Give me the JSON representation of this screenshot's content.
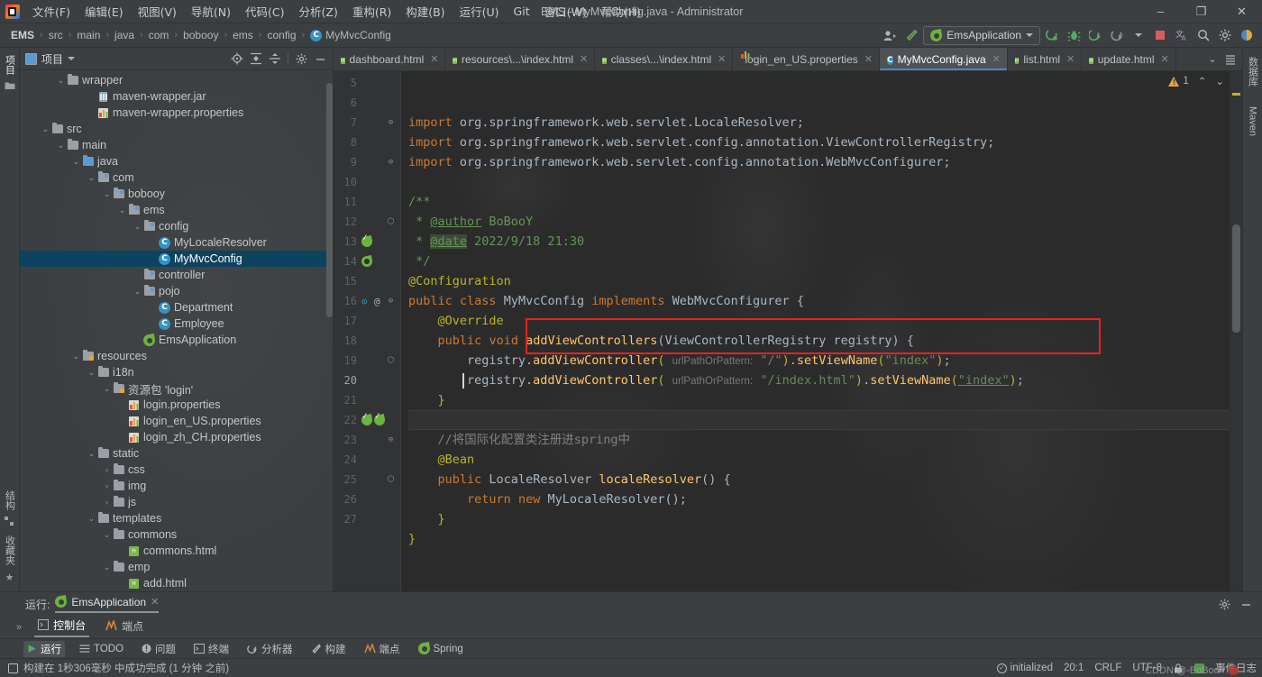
{
  "window": {
    "title": "EMS - MyMvcConfig.java - Administrator",
    "minimize": "–",
    "maximize": "❐",
    "close": "✕"
  },
  "menubar": {
    "items": [
      "文件(F)",
      "编辑(E)",
      "视图(V)",
      "导航(N)",
      "代码(C)",
      "分析(Z)",
      "重构(R)",
      "构建(B)",
      "运行(U)",
      "Git",
      "窗口(W)",
      "帮助(H)"
    ]
  },
  "navbar": {
    "breadcrumbs": [
      "EMS",
      "src",
      "main",
      "java",
      "com",
      "bobooy",
      "ems",
      "config"
    ],
    "current_file": "MyMvcConfig",
    "current_file_icon": "C",
    "separator": "›",
    "run_config": "EmsApplication",
    "icons": [
      "user-avatar-icon",
      "hammer-build-icon",
      "run-icon",
      "debug-icon",
      "run-with-coverage-icon",
      "profiler-icon",
      "stop-icon",
      "translate-icon",
      "search-everywhere-icon",
      "settings-icon",
      "ide-theme-icon"
    ]
  },
  "left_strip": {
    "top_labels": [
      "项目"
    ],
    "bottom_labels": [
      "结构",
      "收藏夹"
    ]
  },
  "right_strip": {
    "labels": [
      "数据库",
      "Maven"
    ]
  },
  "project_panel": {
    "title": "项目",
    "dropdown_caret": "▾",
    "toolbar_icons": [
      "locate-target-icon",
      "expand-all-icon",
      "collapse-all-icon",
      "settings-gear-icon",
      "hide-panel-icon"
    ],
    "tree": [
      {
        "label": "wrapper",
        "depth": 2,
        "arrow": "⌄",
        "icon": "folder"
      },
      {
        "label": "maven-wrapper.jar",
        "depth": 4,
        "arrow": "",
        "icon": "jar"
      },
      {
        "label": "maven-wrapper.properties",
        "depth": 4,
        "arrow": "",
        "icon": "properties"
      },
      {
        "label": "src",
        "depth": 1,
        "arrow": "⌄",
        "icon": "folder"
      },
      {
        "label": "main",
        "depth": 2,
        "arrow": "⌄",
        "icon": "folder"
      },
      {
        "label": "java",
        "depth": 3,
        "arrow": "⌄",
        "icon": "source-folder"
      },
      {
        "label": "com",
        "depth": 4,
        "arrow": "⌄",
        "icon": "package"
      },
      {
        "label": "bobooy",
        "depth": 5,
        "arrow": "⌄",
        "icon": "package"
      },
      {
        "label": "ems",
        "depth": 6,
        "arrow": "⌄",
        "icon": "package"
      },
      {
        "label": "config",
        "depth": 7,
        "arrow": "⌄",
        "icon": "package"
      },
      {
        "label": "MyLocaleResolver",
        "depth": 8,
        "arrow": "",
        "icon": "class"
      },
      {
        "label": "MyMvcConfig",
        "depth": 8,
        "arrow": "",
        "icon": "class",
        "selected": true
      },
      {
        "label": "controller",
        "depth": 7,
        "arrow": "",
        "icon": "package"
      },
      {
        "label": "pojo",
        "depth": 7,
        "arrow": "⌄",
        "icon": "package"
      },
      {
        "label": "Department",
        "depth": 8,
        "arrow": "",
        "icon": "class"
      },
      {
        "label": "Employee",
        "depth": 8,
        "arrow": "",
        "icon": "class"
      },
      {
        "label": "EmsApplication",
        "depth": 7,
        "arrow": "",
        "icon": "spring-class"
      },
      {
        "label": "resources",
        "depth": 3,
        "arrow": "⌄",
        "icon": "resource-folder"
      },
      {
        "label": "i18n",
        "depth": 4,
        "arrow": "⌄",
        "icon": "folder"
      },
      {
        "label": "资源包 'login'",
        "depth": 5,
        "arrow": "⌄",
        "icon": "resource-bundle"
      },
      {
        "label": "login.properties",
        "depth": 6,
        "arrow": "",
        "icon": "properties"
      },
      {
        "label": "login_en_US.properties",
        "depth": 6,
        "arrow": "",
        "icon": "properties"
      },
      {
        "label": "login_zh_CH.properties",
        "depth": 6,
        "arrow": "",
        "icon": "properties"
      },
      {
        "label": "static",
        "depth": 4,
        "arrow": "⌄",
        "icon": "folder"
      },
      {
        "label": "css",
        "depth": 5,
        "arrow": "›",
        "icon": "folder"
      },
      {
        "label": "img",
        "depth": 5,
        "arrow": "›",
        "icon": "folder"
      },
      {
        "label": "js",
        "depth": 5,
        "arrow": "›",
        "icon": "folder"
      },
      {
        "label": "templates",
        "depth": 4,
        "arrow": "⌄",
        "icon": "folder"
      },
      {
        "label": "commons",
        "depth": 5,
        "arrow": "⌄",
        "icon": "folder"
      },
      {
        "label": "commons.html",
        "depth": 6,
        "arrow": "",
        "icon": "html"
      },
      {
        "label": "emp",
        "depth": 5,
        "arrow": "⌄",
        "icon": "folder"
      },
      {
        "label": "add.html",
        "depth": 6,
        "arrow": "",
        "icon": "html"
      }
    ]
  },
  "editor": {
    "tabs": [
      {
        "label": "dashboard.html",
        "icon": "html",
        "active": false
      },
      {
        "label": "resources\\...\\index.html",
        "icon": "html",
        "active": false
      },
      {
        "label": "classes\\...\\index.html",
        "icon": "html",
        "active": false
      },
      {
        "label": "login_en_US.properties",
        "icon": "properties",
        "active": false
      },
      {
        "label": "MyMvcConfig.java",
        "icon": "class",
        "active": true
      },
      {
        "label": "list.html",
        "icon": "html",
        "active": false
      },
      {
        "label": "update.html",
        "icon": "html",
        "active": false
      }
    ],
    "tab_close_glyph": "✕",
    "tab_overflow_glyph": "⌄",
    "inspection": {
      "warning_count": "1",
      "up": "⌃",
      "down": "⌄"
    },
    "lines": [
      {
        "num": "5",
        "gutter": [],
        "fold": ""
      },
      {
        "num": "6",
        "gutter": [],
        "fold": ""
      },
      {
        "num": "7",
        "gutter": [],
        "fold": "⊖"
      },
      {
        "num": "8",
        "gutter": [],
        "fold": ""
      },
      {
        "num": "9",
        "gutter": [],
        "fold": "⊖"
      },
      {
        "num": "10",
        "gutter": [],
        "fold": ""
      },
      {
        "num": "11",
        "gutter": [],
        "fold": ""
      },
      {
        "num": "12",
        "gutter": [],
        "fold": "⬡"
      },
      {
        "num": "13",
        "gutter": [
          "bean"
        ],
        "fold": ""
      },
      {
        "num": "14",
        "gutter": [
          "run"
        ],
        "fold": ""
      },
      {
        "num": "15",
        "gutter": [],
        "fold": ""
      },
      {
        "num": "16",
        "gutter": [
          "impl",
          "at"
        ],
        "fold": "⊖"
      },
      {
        "num": "17",
        "gutter": [],
        "fold": ""
      },
      {
        "num": "18",
        "gutter": [],
        "fold": ""
      },
      {
        "num": "19",
        "gutter": [],
        "fold": "⬡"
      },
      {
        "num": "20",
        "gutter": [],
        "fold": "",
        "current": true
      },
      {
        "num": "21",
        "gutter": [],
        "fold": ""
      },
      {
        "num": "22",
        "gutter": [
          "bean2",
          "bean"
        ],
        "fold": ""
      },
      {
        "num": "23",
        "gutter": [],
        "fold": "⊖"
      },
      {
        "num": "24",
        "gutter": [],
        "fold": ""
      },
      {
        "num": "25",
        "gutter": [],
        "fold": "⬡"
      },
      {
        "num": "26",
        "gutter": [],
        "fold": ""
      },
      {
        "num": "27",
        "gutter": [],
        "fold": ""
      }
    ],
    "source_text": [
      "import org.springframework.web.servlet.LocaleResolver;",
      "import org.springframework.web.servlet.config.annotation.ViewControllerRegistry;",
      "import org.springframework.web.servlet.config.annotation.WebMvcConfigurer;",
      "",
      "/**",
      " * @author BoBooY",
      " * @date 2022/9/18 21:30",
      " */",
      "@Configuration",
      "public class MyMvcConfig implements WebMvcConfigurer {",
      "    @Override",
      "    public void addViewControllers(ViewControllerRegistry registry) {",
      "        registry.addViewController( urlPathOrPattern: \"/\").setViewName(\"index\");",
      "        registry.addViewController( urlPathOrPattern: \"/index.html\").setViewName(\"index\");",
      "    }",
      "",
      "    //将国际化配置类注册进spring中",
      "    @Bean",
      "    public LocaleResolver localeResolver() {",
      "        return new MyLocaleResolver();",
      "    }",
      "}",
      ""
    ],
    "annotation_highlight": "red-rectangle-around-line-18"
  },
  "run_panel": {
    "label": "运行:",
    "tab": "EmsApplication",
    "tab_close": "✕",
    "overflow": "»",
    "subtabs": [
      {
        "label": "控制台",
        "icon": "console-icon",
        "active": true
      },
      {
        "label": "端点",
        "icon": "endpoints-icon",
        "active": false
      }
    ],
    "settings_icon": "gear-icon",
    "hide_icon": "minimize-icon"
  },
  "tool_buttons": [
    {
      "label": "运行",
      "icon": "run-icon",
      "active": true
    },
    {
      "label": "TODO",
      "icon": "todo-icon",
      "active": false
    },
    {
      "label": "问题",
      "icon": "problems-icon",
      "active": false
    },
    {
      "label": "终端",
      "icon": "terminal-icon",
      "active": false
    },
    {
      "label": "分析器",
      "icon": "profiler-icon",
      "active": false
    },
    {
      "label": "构建",
      "icon": "build-icon",
      "active": false
    },
    {
      "label": "端点",
      "icon": "endpoints-icon",
      "active": false
    },
    {
      "label": "Spring",
      "icon": "spring-icon",
      "active": false
    }
  ],
  "statusbar": {
    "message": "构建在 1秒306毫秒 中成功完成 (1 分钟 之前)",
    "message_icon": "build-status-icon",
    "right": {
      "indexing_state": "initialized",
      "caret_position": "20:1",
      "line_separator": "CRLF",
      "encoding": "UTF-8",
      "event_log": "事件日志"
    },
    "watermark": "CDDN @-BoBooY"
  },
  "colors": {
    "accent_blue": "#4a88c7",
    "selection_blue": "#0d435e",
    "keyword_orange": "#cc7832",
    "string_green": "#6a8759",
    "annotation_yellow": "#bbb529",
    "javadoc_green": "#629755",
    "method_yellow": "#ffc66d",
    "highlight_red": "#e8211f",
    "panel_bg": "#3c3f41",
    "editor_bg": "#2b2b2b"
  }
}
